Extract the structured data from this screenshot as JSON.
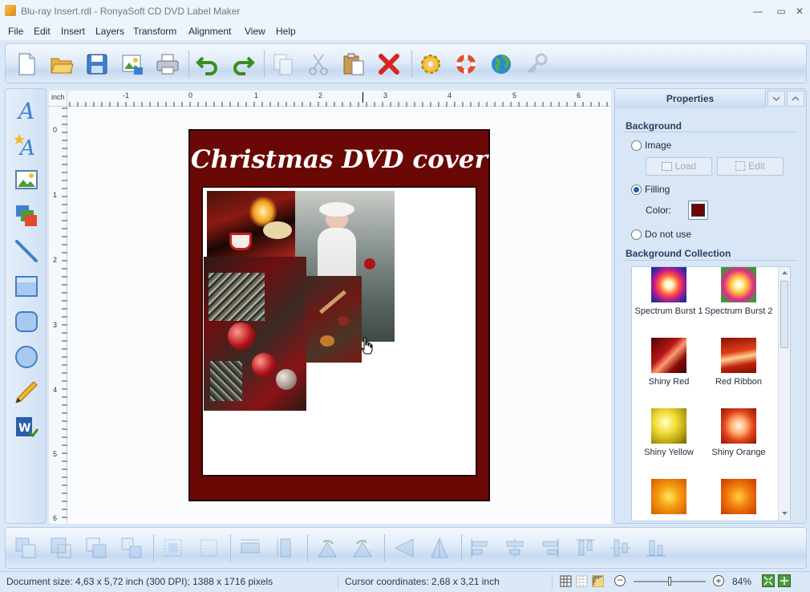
{
  "window": {
    "title": "Blu-ray Insert.rdl - RonyaSoft CD DVD Label Maker",
    "minimize": "—",
    "maximize": "▭",
    "close": "✕"
  },
  "menu": [
    "File",
    "Edit",
    "Insert",
    "Layers",
    "Transform",
    "Alignment",
    "View",
    "Help"
  ],
  "toolbar": {
    "icons": [
      "new-document",
      "open-folder",
      "save",
      "export-image",
      "print",
      "undo",
      "redo",
      "copy",
      "cut",
      "paste",
      "delete",
      "settings",
      "help-lifebuoy",
      "web-globe",
      "register-key"
    ]
  },
  "left_tools": {
    "icons": [
      "text-tool",
      "artistic-text-tool",
      "image-tool",
      "layers-tool",
      "line-tool",
      "rectangle-tool",
      "rounded-rectangle-tool",
      "ellipse-tool",
      "pencil-tool",
      "word-import-tool"
    ]
  },
  "ruler": {
    "unit": "inch",
    "h_labels": [
      "-1",
      "0",
      "1",
      "2",
      "3",
      "4",
      "5",
      "6"
    ],
    "v_labels": [
      "0",
      "1",
      "2",
      "3",
      "4",
      "5",
      "6"
    ]
  },
  "cover": {
    "title": "Christmas DVD cover",
    "background_color": "#6a0805"
  },
  "properties": {
    "tab_label": "Properties",
    "background_section": "Background",
    "option_image": "Image",
    "load_button": "Load",
    "edit_button": "Edit",
    "option_filling": "Filling",
    "color_label": "Color:",
    "color_value": "#6a0805",
    "option_none": "Do not use",
    "selected_option": "Filling",
    "collection_section": "Background Collection",
    "collection": [
      "Spectrum Burst 1",
      "Spectrum Burst 2",
      "Shiny Red",
      "Red Ribbon",
      "Shiny Yellow",
      "Shiny Orange"
    ]
  },
  "status": {
    "document_size": "Document size: 4,63 x 5,72 inch (300 DPI); 1388 x 1716 pixels",
    "cursor": "Cursor coordinates: 2,68 x 3,21 inch",
    "zoom": "84%",
    "zoom_out": "−",
    "zoom_in": "+",
    "zoom_level": 0.5
  }
}
